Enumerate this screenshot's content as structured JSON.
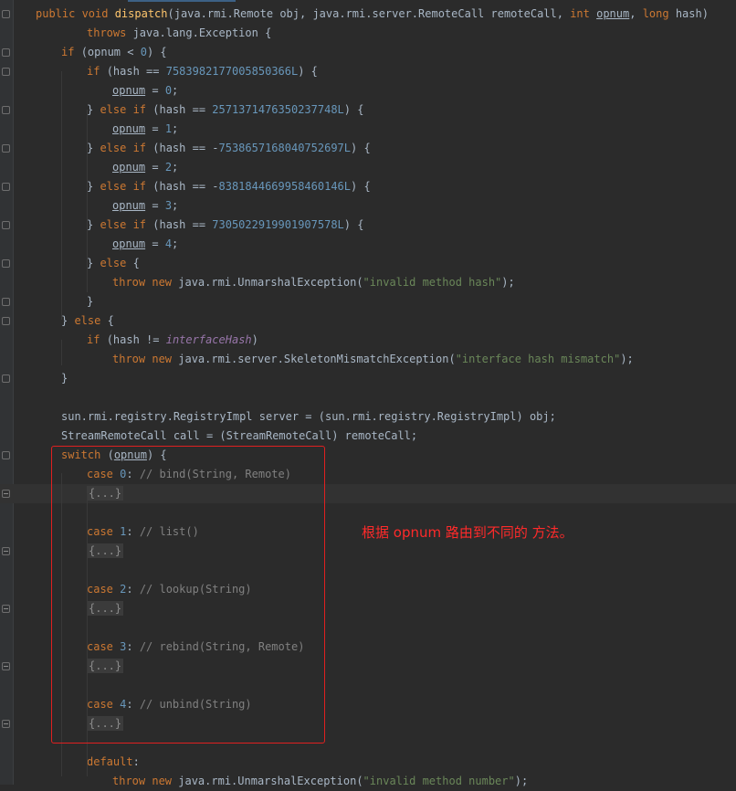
{
  "editor": {
    "lines": [
      {
        "indent": 0,
        "fold": "open",
        "tokens": [
          [
            "kw",
            "public "
          ],
          [
            "kw",
            "void "
          ],
          [
            "fn",
            "dispatch"
          ],
          [
            "p",
            "(java.rmi.Remote obj, java.rmi.server.RemoteCall remoteCall, "
          ],
          [
            "kw",
            "int "
          ],
          [
            "ul",
            "opnum"
          ],
          [
            "p",
            ", "
          ],
          [
            "kw",
            "long "
          ],
          [
            "p",
            "hash)"
          ]
        ]
      },
      {
        "indent": 2,
        "tokens": [
          [
            "kw",
            "throws "
          ],
          [
            "p",
            "java.lang.Exception {"
          ]
        ]
      },
      {
        "indent": 1,
        "fold": "open",
        "tokens": [
          [
            "kw",
            "if "
          ],
          [
            "p",
            "(opnum < "
          ],
          [
            "num",
            "0"
          ],
          [
            "p",
            ") {"
          ]
        ]
      },
      {
        "indent": 2,
        "fold": "open",
        "tokens": [
          [
            "kw",
            "if "
          ],
          [
            "p",
            "(hash == "
          ],
          [
            "num",
            "7583982177005850366L"
          ],
          [
            "p",
            ") {"
          ]
        ]
      },
      {
        "indent": 3,
        "tokens": [
          [
            "ul",
            "opnum"
          ],
          [
            "p",
            " = "
          ],
          [
            "num",
            "0"
          ],
          [
            "p",
            ";"
          ]
        ]
      },
      {
        "indent": 2,
        "fold": "open",
        "tokens": [
          [
            "p",
            "} "
          ],
          [
            "kw",
            "else if "
          ],
          [
            "p",
            "(hash == "
          ],
          [
            "num",
            "2571371476350237748L"
          ],
          [
            "p",
            ") {"
          ]
        ]
      },
      {
        "indent": 3,
        "tokens": [
          [
            "ul",
            "opnum"
          ],
          [
            "p",
            " = "
          ],
          [
            "num",
            "1"
          ],
          [
            "p",
            ";"
          ]
        ]
      },
      {
        "indent": 2,
        "fold": "open",
        "tokens": [
          [
            "p",
            "} "
          ],
          [
            "kw",
            "else if "
          ],
          [
            "p",
            "(hash == -"
          ],
          [
            "num",
            "7538657168040752697L"
          ],
          [
            "p",
            ") {"
          ]
        ]
      },
      {
        "indent": 3,
        "tokens": [
          [
            "ul",
            "opnum"
          ],
          [
            "p",
            " = "
          ],
          [
            "num",
            "2"
          ],
          [
            "p",
            ";"
          ]
        ]
      },
      {
        "indent": 2,
        "fold": "open",
        "tokens": [
          [
            "p",
            "} "
          ],
          [
            "kw",
            "else if "
          ],
          [
            "p",
            "(hash == -"
          ],
          [
            "num",
            "8381844669958460146L"
          ],
          [
            "p",
            ") {"
          ]
        ]
      },
      {
        "indent": 3,
        "tokens": [
          [
            "ul",
            "opnum"
          ],
          [
            "p",
            " = "
          ],
          [
            "num",
            "3"
          ],
          [
            "p",
            ";"
          ]
        ]
      },
      {
        "indent": 2,
        "fold": "open",
        "tokens": [
          [
            "p",
            "} "
          ],
          [
            "kw",
            "else if "
          ],
          [
            "p",
            "(hash == "
          ],
          [
            "num",
            "7305022919901907578L"
          ],
          [
            "p",
            ") {"
          ]
        ]
      },
      {
        "indent": 3,
        "tokens": [
          [
            "ul",
            "opnum"
          ],
          [
            "p",
            " = "
          ],
          [
            "num",
            "4"
          ],
          [
            "p",
            ";"
          ]
        ]
      },
      {
        "indent": 2,
        "fold": "open",
        "tokens": [
          [
            "p",
            "} "
          ],
          [
            "kw",
            "else "
          ],
          [
            "p",
            "{"
          ]
        ]
      },
      {
        "indent": 3,
        "tokens": [
          [
            "kw",
            "throw new "
          ],
          [
            "p",
            "java.rmi.UnmarshalException("
          ],
          [
            "str",
            "\"invalid method hash\""
          ],
          [
            "p",
            ");"
          ]
        ]
      },
      {
        "indent": 2,
        "fold": "open",
        "tokens": [
          [
            "p",
            "}"
          ]
        ]
      },
      {
        "indent": 1,
        "fold": "open",
        "tokens": [
          [
            "p",
            "} "
          ],
          [
            "kw",
            "else "
          ],
          [
            "p",
            "{"
          ]
        ]
      },
      {
        "indent": 2,
        "tokens": [
          [
            "kw",
            "if "
          ],
          [
            "p",
            "(hash != "
          ],
          [
            "field",
            "interfaceHash"
          ],
          [
            "p",
            ")"
          ]
        ]
      },
      {
        "indent": 3,
        "tokens": [
          [
            "kw",
            "throw new "
          ],
          [
            "p",
            "java.rmi.server.SkeletonMismatchException("
          ],
          [
            "str",
            "\"interface hash mismatch\""
          ],
          [
            "p",
            ");"
          ]
        ]
      },
      {
        "indent": 1,
        "fold": "open",
        "tokens": [
          [
            "p",
            "}"
          ]
        ]
      },
      {
        "indent": 1,
        "tokens": []
      },
      {
        "indent": 1,
        "tokens": [
          [
            "p",
            "sun.rmi.registry.RegistryImpl server = (sun.rmi.registry.RegistryImpl) obj;"
          ]
        ]
      },
      {
        "indent": 1,
        "tokens": [
          [
            "p",
            "StreamRemoteCall call = (StreamRemoteCall) remoteCall;"
          ]
        ]
      },
      {
        "indent": 1,
        "fold": "open",
        "tokens": [
          [
            "kw",
            "switch "
          ],
          [
            "p",
            "("
          ],
          [
            "ul",
            "opnum"
          ],
          [
            "p",
            ") {"
          ]
        ]
      },
      {
        "indent": 2,
        "tokens": [
          [
            "kw",
            "case "
          ],
          [
            "num",
            "0"
          ],
          [
            "p",
            ": "
          ],
          [
            "cmt",
            "// bind(String, Remote)"
          ]
        ]
      },
      {
        "indent": 2,
        "fold": "collapsed",
        "caret": true,
        "tokens": [
          [
            "folded",
            "{...}"
          ]
        ]
      },
      {
        "indent": 2,
        "tokens": []
      },
      {
        "indent": 2,
        "tokens": [
          [
            "kw",
            "case "
          ],
          [
            "num",
            "1"
          ],
          [
            "p",
            ": "
          ],
          [
            "cmt",
            "// list()"
          ]
        ]
      },
      {
        "indent": 2,
        "fold": "collapsed",
        "tokens": [
          [
            "folded",
            "{...}"
          ]
        ]
      },
      {
        "indent": 2,
        "tokens": []
      },
      {
        "indent": 2,
        "tokens": [
          [
            "kw",
            "case "
          ],
          [
            "num",
            "2"
          ],
          [
            "p",
            ": "
          ],
          [
            "cmt",
            "// lookup(String)"
          ]
        ]
      },
      {
        "indent": 2,
        "fold": "collapsed",
        "tokens": [
          [
            "folded",
            "{...}"
          ]
        ]
      },
      {
        "indent": 2,
        "tokens": []
      },
      {
        "indent": 2,
        "tokens": [
          [
            "kw",
            "case "
          ],
          [
            "num",
            "3"
          ],
          [
            "p",
            ": "
          ],
          [
            "cmt",
            "// rebind(String, Remote)"
          ]
        ]
      },
      {
        "indent": 2,
        "fold": "collapsed",
        "tokens": [
          [
            "folded",
            "{...}"
          ]
        ]
      },
      {
        "indent": 2,
        "tokens": []
      },
      {
        "indent": 2,
        "tokens": [
          [
            "kw",
            "case "
          ],
          [
            "num",
            "4"
          ],
          [
            "p",
            ": "
          ],
          [
            "cmt",
            "// unbind(String)"
          ]
        ]
      },
      {
        "indent": 2,
        "fold": "collapsed",
        "tokens": [
          [
            "folded",
            "{...}"
          ]
        ]
      },
      {
        "indent": 2,
        "tokens": []
      },
      {
        "indent": 2,
        "tokens": [
          [
            "kw",
            "default"
          ],
          [
            "p",
            ":"
          ]
        ]
      },
      {
        "indent": 3,
        "tokens": [
          [
            "kw",
            "throw new "
          ],
          [
            "p",
            "java.rmi.UnmarshalException("
          ],
          [
            "str",
            "\"invalid method number\""
          ],
          [
            "p",
            ");"
          ]
        ]
      }
    ]
  },
  "annotation": {
    "text": "根据 opnum 路由到不同的 方法。",
    "color": "#ff2a2a"
  }
}
